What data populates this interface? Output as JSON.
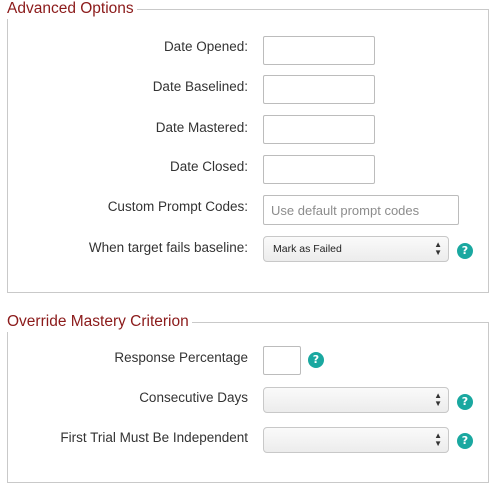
{
  "advanced_options": {
    "legend": "Advanced Options",
    "date_opened": {
      "label": "Date Opened:",
      "value": ""
    },
    "date_baselined": {
      "label": "Date Baselined:",
      "value": ""
    },
    "date_mastered": {
      "label": "Date Mastered:",
      "value": ""
    },
    "date_closed": {
      "label": "Date Closed:",
      "value": ""
    },
    "custom_prompt_codes": {
      "label": "Custom Prompt Codes:",
      "value": "",
      "placeholder": "Use default prompt codes"
    },
    "baseline_fail": {
      "label": "When target fails baseline:",
      "selected": "Mark as Failed",
      "help_icon": "question-circle-icon"
    }
  },
  "override_mastery": {
    "legend": "Override Mastery Criterion",
    "response_percentage": {
      "label": "Response Percentage",
      "value": "",
      "help_icon": "question-circle-icon"
    },
    "consecutive_days": {
      "label": "Consecutive Days",
      "selected": "",
      "help_icon": "question-circle-icon"
    },
    "first_trial_independent": {
      "label": "First Trial Must Be Independent",
      "selected": "",
      "help_icon": "question-circle-icon"
    }
  },
  "icons": {
    "help_glyph": "?",
    "select_arrows": "▲▼"
  },
  "colors": {
    "legend_text": "#8b1a1a",
    "help_icon_bg": "#1aa8a0",
    "fieldset_border": "#c9c9c9"
  }
}
